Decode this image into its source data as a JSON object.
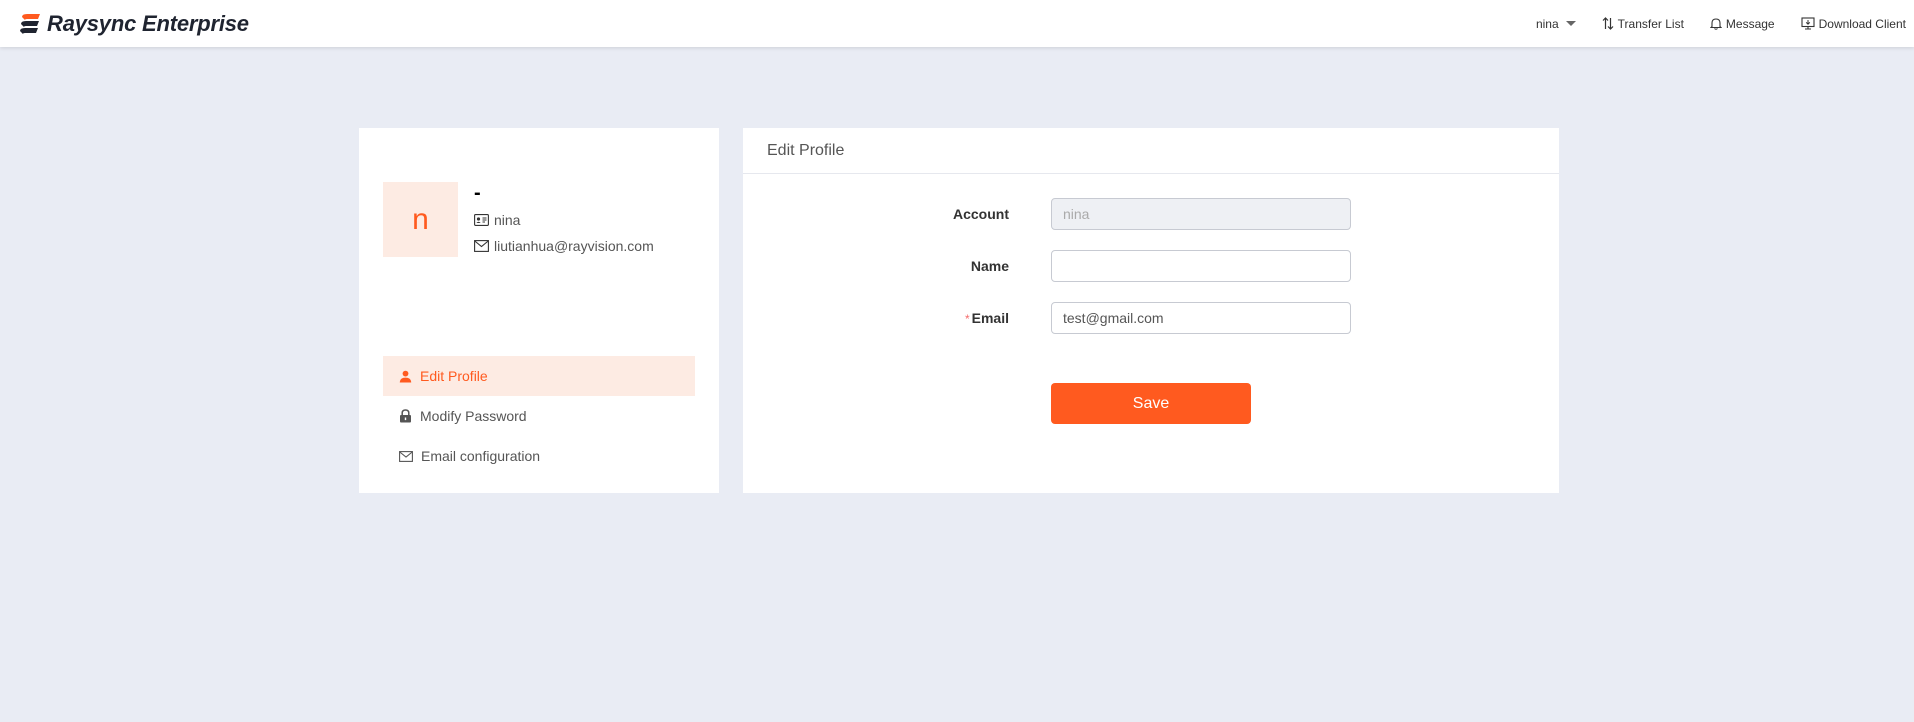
{
  "app": {
    "brand": "Raysync Enterprise",
    "accent_color": "#ff5a1f"
  },
  "header": {
    "user": "nina",
    "nav": [
      {
        "label": "Transfer List",
        "icon": "transfer-icon"
      },
      {
        "label": "Message",
        "icon": "bell-icon"
      },
      {
        "label": "Download Client",
        "icon": "monitor-download-icon"
      }
    ]
  },
  "profile": {
    "avatar_letter": "n",
    "display_name": "-",
    "username": "nina",
    "email": "liutianhua@rayvision.com"
  },
  "menu": {
    "items": [
      {
        "label": "Edit Profile",
        "icon": "user-icon",
        "active": true
      },
      {
        "label": "Modify Password",
        "icon": "lock-icon",
        "active": false
      },
      {
        "label": "Email configuration",
        "icon": "mail-icon",
        "active": false
      }
    ]
  },
  "form": {
    "title": "Edit Profile",
    "account": {
      "label": "Account",
      "value": "nina"
    },
    "name": {
      "label": "Name",
      "value": ""
    },
    "email": {
      "label": "Email",
      "value": "test@gmail.com",
      "required_mark": "*"
    },
    "save_label": "Save"
  }
}
